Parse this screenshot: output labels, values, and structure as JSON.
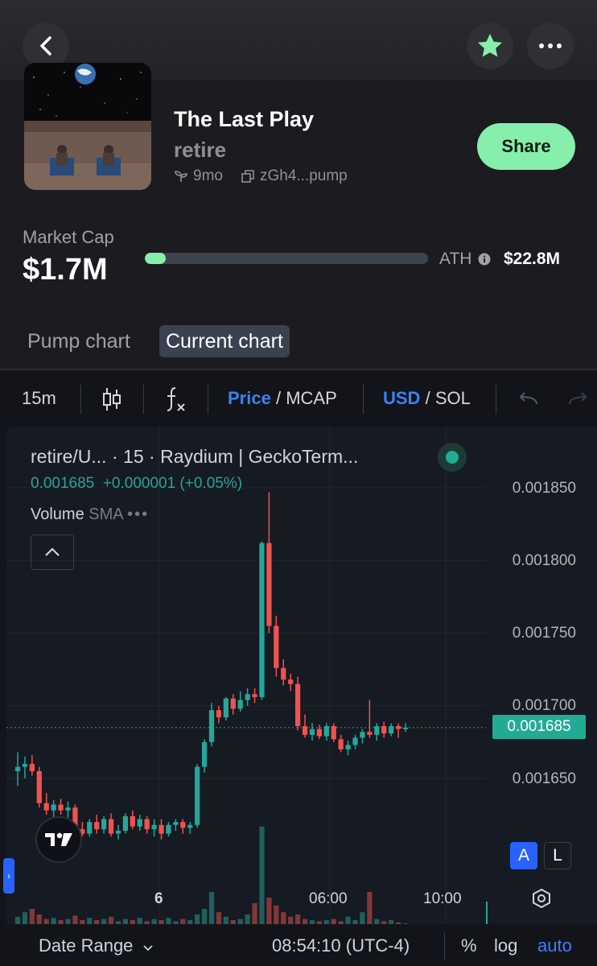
{
  "header": {
    "back_icon": "chevron-left-icon",
    "favorite_icon": "star-icon",
    "more_icon": "ellipsis-icon",
    "accent": "#86efac"
  },
  "token": {
    "name": "The Last Play",
    "ticker": "retire",
    "age": "9mo",
    "address": "zGh4...pump",
    "share_label": "Share"
  },
  "market": {
    "cap_label": "Market Cap",
    "cap_value": "$1.7M",
    "ath_label": "ATH",
    "ath_value": "$22.8M",
    "ath_progress": 0.075
  },
  "chart_tabs": [
    {
      "label": "Pump chart",
      "active": false
    },
    {
      "label": "Current chart",
      "active": true
    }
  ],
  "toolbar": {
    "interval": "15m",
    "price_label": "Price",
    "mcap_label": "MCAP",
    "usd_label": "USD",
    "sol_label": "SOL",
    "sep": "/"
  },
  "chart_header": {
    "symbol": "retire/U...",
    "interval": "15",
    "source": "Raydium | GeckoTerm...",
    "last": "0.001685",
    "change": "+0.000001 (+0.05%)",
    "volume_label": "Volume",
    "sma_label": "SMA",
    "a_label": "A",
    "l_label": "L"
  },
  "chart_data": {
    "type": "candlestick",
    "y_ticks": [
      "0.001850",
      "0.001800",
      "0.001750",
      "0.001700",
      "0.001650"
    ],
    "ylim": [
      0.0016,
      0.00187
    ],
    "x_ticks": [
      "6",
      "06:00",
      "10:00"
    ],
    "current_price": "0.001685",
    "up_color": "#26a69a",
    "down_color": "#ef5350",
    "candles": [
      [
        0.001655,
        0.001668,
        0.001645,
        0.001658
      ],
      [
        0.001658,
        0.001665,
        0.00165,
        0.00166
      ],
      [
        0.00166,
        0.001666,
        0.001652,
        0.001655
      ],
      [
        0.001655,
        0.001658,
        0.00163,
        0.001633
      ],
      [
        0.001633,
        0.00164,
        0.001625,
        0.001628
      ],
      [
        0.001628,
        0.001635,
        0.001622,
        0.001632
      ],
      [
        0.001632,
        0.001636,
        0.001625,
        0.001628
      ],
      [
        0.001628,
        0.001634,
        0.001623,
        0.00163
      ],
      [
        0.00163,
        0.001632,
        0.001612,
        0.001615
      ],
      [
        0.001615,
        0.00162,
        0.00161,
        0.001612
      ],
      [
        0.001612,
        0.001622,
        0.00161,
        0.00162
      ],
      [
        0.00162,
        0.001625,
        0.001612,
        0.001615
      ],
      [
        0.001615,
        0.001624,
        0.001612,
        0.001622
      ],
      [
        0.001622,
        0.001626,
        0.00161,
        0.001612
      ],
      [
        0.001612,
        0.001618,
        0.001608,
        0.001614
      ],
      [
        0.001614,
        0.001626,
        0.001612,
        0.001624
      ],
      [
        0.001624,
        0.001628,
        0.001615,
        0.001617
      ],
      [
        0.001617,
        0.001625,
        0.001614,
        0.001622
      ],
      [
        0.001622,
        0.001624,
        0.001612,
        0.001615
      ],
      [
        0.001615,
        0.001622,
        0.00161,
        0.001618
      ],
      [
        0.001618,
        0.001622,
        0.001608,
        0.001612
      ],
      [
        0.001612,
        0.00162,
        0.00161,
        0.001618
      ],
      [
        0.001618,
        0.001622,
        0.001614,
        0.00162
      ],
      [
        0.00162,
        0.001622,
        0.001612,
        0.001616
      ],
      [
        0.001616,
        0.00162,
        0.001612,
        0.001618
      ],
      [
        0.001618,
        0.00166,
        0.001616,
        0.001658
      ],
      [
        0.001658,
        0.001677,
        0.001654,
        0.001675
      ],
      [
        0.001675,
        0.001702,
        0.001672,
        0.001697
      ],
      [
        0.001697,
        0.0017,
        0.001688,
        0.001692
      ],
      [
        0.001692,
        0.001706,
        0.00169,
        0.001705
      ],
      [
        0.001705,
        0.001708,
        0.001694,
        0.001698
      ],
      [
        0.001698,
        0.00171,
        0.001696,
        0.001704
      ],
      [
        0.001704,
        0.001712,
        0.0017,
        0.001708
      ],
      [
        0.001708,
        0.001712,
        0.001702,
        0.001706
      ],
      [
        0.001706,
        0.001813,
        0.001704,
        0.001812
      ],
      [
        0.001812,
        0.001847,
        0.00175,
        0.001755
      ],
      [
        0.001755,
        0.001762,
        0.00172,
        0.001726
      ],
      [
        0.001726,
        0.001732,
        0.001714,
        0.001718
      ],
      [
        0.001718,
        0.001722,
        0.00171,
        0.001715
      ],
      [
        0.001715,
        0.00172,
        0.001683,
        0.001686
      ],
      [
        0.001686,
        0.001694,
        0.001678,
        0.00168
      ],
      [
        0.00168,
        0.001688,
        0.001676,
        0.001684
      ],
      [
        0.001684,
        0.001687,
        0.001677,
        0.001679
      ],
      [
        0.001679,
        0.001688,
        0.001676,
        0.001686
      ],
      [
        0.001686,
        0.001688,
        0.001675,
        0.001677
      ],
      [
        0.001677,
        0.00168,
        0.001668,
        0.00167
      ],
      [
        0.00167,
        0.001676,
        0.001666,
        0.001673
      ],
      [
        0.001673,
        0.00168,
        0.00167,
        0.001678
      ],
      [
        0.001678,
        0.001684,
        0.001674,
        0.001682
      ],
      [
        0.001682,
        0.001704,
        0.001678,
        0.00168
      ],
      [
        0.00168,
        0.001688,
        0.001676,
        0.001686
      ],
      [
        0.001686,
        0.001689,
        0.001678,
        0.001681
      ],
      [
        0.001681,
        0.001688,
        0.001679,
        0.001686
      ],
      [
        0.001686,
        0.001688,
        0.001678,
        0.001684
      ],
      [
        0.001684,
        0.001688,
        0.001682,
        0.001685
      ]
    ],
    "volumes": [
      0.08,
      0.12,
      0.15,
      0.1,
      0.06,
      0.07,
      0.05,
      0.06,
      0.09,
      0.05,
      0.07,
      0.05,
      0.06,
      0.08,
      0.04,
      0.06,
      0.05,
      0.07,
      0.04,
      0.06,
      0.05,
      0.07,
      0.04,
      0.06,
      0.05,
      0.1,
      0.15,
      0.3,
      0.12,
      0.08,
      0.05,
      0.06,
      0.1,
      0.2,
      0.88,
      0.25,
      0.18,
      0.12,
      0.08,
      0.1,
      0.06,
      0.05,
      0.04,
      0.05,
      0.06,
      0.04,
      0.08,
      0.05,
      0.12,
      0.3,
      0.06,
      0.04,
      0.05,
      0.03,
      0.02
    ]
  },
  "footer": {
    "date_range": "Date Range",
    "time": "08:54:10 (UTC-4)",
    "percent": "%",
    "log": "log",
    "auto": "auto"
  }
}
